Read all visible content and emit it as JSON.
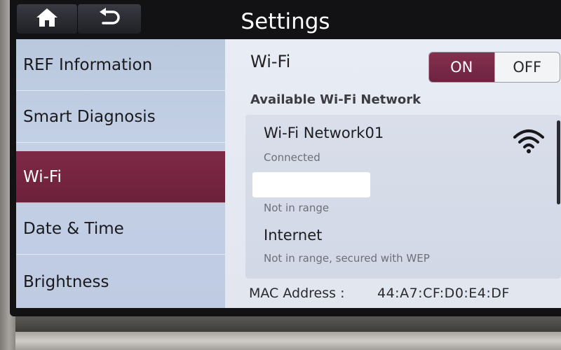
{
  "header": {
    "title": "Settings",
    "home_icon": "home-icon",
    "back_icon": "back-arrow-icon"
  },
  "menu": {
    "items": [
      {
        "label": "REF Information",
        "active": false
      },
      {
        "label": "Smart Diagnosis",
        "active": false
      },
      {
        "label": "Wi-Fi",
        "active": true
      },
      {
        "label": "Date & Time",
        "active": false
      },
      {
        "label": "Brightness",
        "active": false
      }
    ]
  },
  "wifi": {
    "label": "Wi-Fi",
    "toggle": {
      "on_label": "ON",
      "off_label": "OFF",
      "selected": "ON"
    },
    "section_title": "Available Wi-Fi Network",
    "networks": [
      {
        "name": "Wi-Fi Network01",
        "status": "Connected",
        "icon": "wifi-signal-icon"
      },
      {
        "name": "",
        "status": "Not in range"
      },
      {
        "name": "Internet",
        "status": "Not in range, secured with WEP"
      }
    ],
    "mac_label": "MAC Address :",
    "mac_value": "44:A7:CF:D0:E4:DF"
  },
  "colors": {
    "accent": "#7a2844",
    "menu_bg": "#c0cde3",
    "panel_bg": "#e6eaf2"
  }
}
